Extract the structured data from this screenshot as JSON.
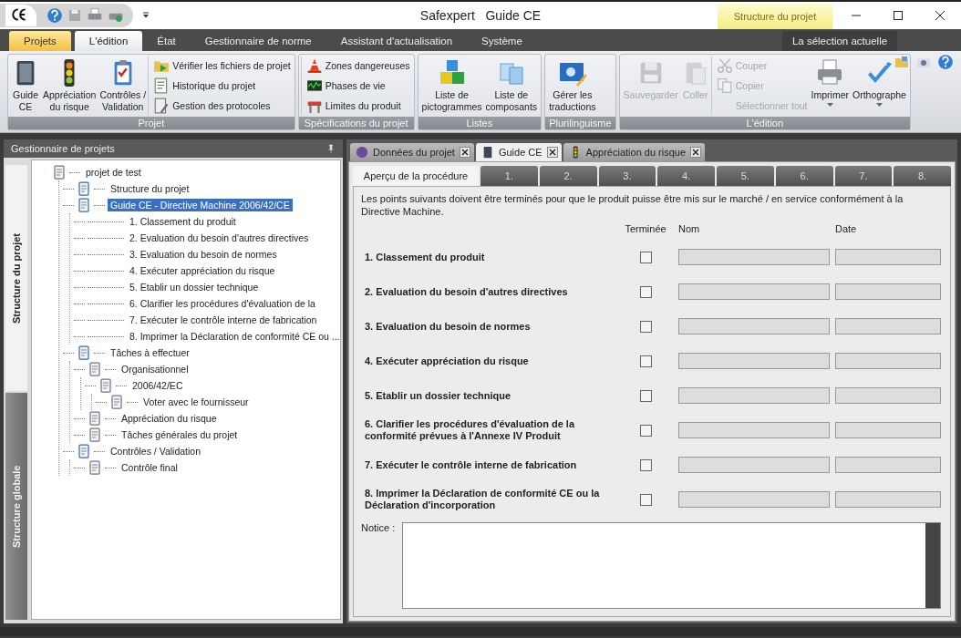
{
  "window": {
    "title": "Safexpert   Guide CE",
    "context_header": "Structure du projet"
  },
  "ribbon_tabs": [
    {
      "label": "Projets",
      "kind": "app",
      "selected": false
    },
    {
      "label": "L'édition",
      "kind": "tab",
      "selected": true
    },
    {
      "label": "État",
      "kind": "tab",
      "selected": false
    },
    {
      "label": "Gestionnaire de norme",
      "kind": "tab",
      "selected": false
    },
    {
      "label": "Assistant d'actualisation",
      "kind": "tab",
      "selected": false
    },
    {
      "label": "Système",
      "kind": "tab",
      "selected": false
    },
    {
      "label": "La sélection actuelle",
      "kind": "context",
      "selected": false
    }
  ],
  "ribbon_groups": [
    {
      "title": "Projet",
      "columns": [
        {
          "kind": "large",
          "label": "Guide\nCE",
          "disabled": false,
          "dropdown": false
        },
        {
          "kind": "large",
          "label": "Appréciation\ndu risque",
          "disabled": false,
          "dropdown": false
        },
        {
          "kind": "large",
          "label": "Contrôles /\nValidation",
          "disabled": false,
          "dropdown": false
        },
        {
          "kind": "stack",
          "items": [
            {
              "label": "Vérifier les fichiers de projet",
              "disabled": false
            },
            {
              "label": "Historique du projet",
              "disabled": false
            },
            {
              "label": "Gestion des protocoles",
              "disabled": false
            }
          ]
        }
      ]
    },
    {
      "title": "Spécifications du projet",
      "columns": [
        {
          "kind": "stack",
          "items": [
            {
              "label": "Zones dangereuses",
              "disabled": false
            },
            {
              "label": "Phases de vie",
              "disabled": false
            },
            {
              "label": "Limites du produit",
              "disabled": false
            }
          ]
        }
      ]
    },
    {
      "title": "Listes",
      "columns": [
        {
          "kind": "large",
          "label": "Liste de\npictogrammes",
          "disabled": false,
          "dropdown": false
        },
        {
          "kind": "large",
          "label": "Liste de\ncomposants",
          "disabled": false,
          "dropdown": false
        }
      ]
    },
    {
      "title": "Plurilinguisme",
      "columns": [
        {
          "kind": "large",
          "label": "Gérer les\ntraductions",
          "disabled": false,
          "dropdown": false
        }
      ]
    },
    {
      "title": "L'édition",
      "columns": [
        {
          "kind": "large",
          "label": "Sauvegarder",
          "disabled": true,
          "dropdown": false
        },
        {
          "kind": "large",
          "label": "Coller",
          "disabled": true,
          "dropdown": false
        },
        {
          "kind": "stack",
          "items": [
            {
              "label": "Couper",
              "disabled": true
            },
            {
              "label": "Copier",
              "disabled": true
            },
            {
              "label": "Sélectionner tout",
              "disabled": true
            }
          ]
        },
        {
          "kind": "large",
          "label": "Imprimer",
          "disabled": false,
          "dropdown": true
        },
        {
          "kind": "large",
          "label": "Orthographe",
          "disabled": false,
          "dropdown": true
        }
      ]
    }
  ],
  "project_manager": {
    "title": "Gestionnaire de projets",
    "side_tabs": [
      {
        "label": "Structure du projet",
        "selected": true
      },
      {
        "label": "Structure globale",
        "selected": false
      }
    ],
    "tree": [
      {
        "label": "projet de test",
        "kind": "document",
        "selected": false,
        "children": [
          {
            "label": "Structure du projet",
            "kind": "document",
            "selected": false
          },
          {
            "label": "Guide CE - Directive Machine 2006/42/CE",
            "kind": "document",
            "selected": true,
            "children": [
              {
                "label": "1. Classement du produit",
                "kind": "step",
                "selected": false
              },
              {
                "label": "2. Evaluation du besoin d'autres directives",
                "kind": "step",
                "selected": false
              },
              {
                "label": "3. Evaluation du besoin de normes",
                "kind": "step",
                "selected": false
              },
              {
                "label": "4. Exécuter appréciation du risque",
                "kind": "step",
                "selected": false
              },
              {
                "label": "5. Etablir un dossier technique",
                "kind": "step",
                "selected": false
              },
              {
                "label": "6. Clarifier les procédures d'évaluation de la",
                "kind": "step",
                "selected": false
              },
              {
                "label": "7. Exécuter le contrôle interne de fabrication",
                "kind": "step",
                "selected": false
              },
              {
                "label": "8. Imprimer la Déclaration de conformité CE ou ...",
                "kind": "step",
                "selected": false
              }
            ]
          },
          {
            "label": "Tâches à effectuer",
            "kind": "document",
            "selected": false,
            "children": [
              {
                "label": "Organisationnel",
                "kind": "document",
                "selected": false,
                "children": [
                  {
                    "label": "2006/42/EC",
                    "kind": "document",
                    "selected": false,
                    "children": [
                      {
                        "label": "Voter avec le fournisseur",
                        "kind": "document",
                        "selected": false
                      }
                    ]
                  }
                ]
              },
              {
                "label": "Appréciation du risque",
                "kind": "document",
                "selected": false
              },
              {
                "label": "Tâches générales du projet",
                "kind": "document",
                "selected": false
              }
            ]
          },
          {
            "label": "Contrôles / Validation",
            "kind": "document",
            "selected": false,
            "children": [
              {
                "label": "Contrôle final",
                "kind": "document",
                "selected": false
              }
            ]
          }
        ]
      }
    ]
  },
  "document_tabs": [
    {
      "label": "Données du projet",
      "selected": false
    },
    {
      "label": "Guide CE",
      "selected": true
    },
    {
      "label": "Appréciation du risque",
      "selected": false
    }
  ],
  "step_tabs": [
    {
      "label": "Aperçu de la procédure",
      "selected": true
    },
    {
      "label": "1.",
      "selected": false
    },
    {
      "label": "2.",
      "selected": false
    },
    {
      "label": "3.",
      "selected": false
    },
    {
      "label": "4.",
      "selected": false
    },
    {
      "label": "5.",
      "selected": false
    },
    {
      "label": "6.",
      "selected": false
    },
    {
      "label": "7.",
      "selected": false
    },
    {
      "label": "8.",
      "selected": false
    }
  ],
  "intro": "Les points suivants doivent être terminés pour que le produit puisse être mis sur le marché / en service conformément à la Directive Machine.",
  "columns": [
    "Terminée",
    "Nom",
    "Date"
  ],
  "steps": [
    {
      "label": "1. Classement du produit",
      "checked": false
    },
    {
      "label": "2. Evaluation du besoin d'autres directives",
      "checked": false
    },
    {
      "label": "3. Evaluation du besoin de normes",
      "checked": false
    },
    {
      "label": "4. Exécuter appréciation du risque",
      "checked": false
    },
    {
      "label": "5. Etablir un dossier technique",
      "checked": false
    },
    {
      "label": "6. Clarifier les procédures d'évaluation de la conformité prévues à l'Annexe IV Produit",
      "checked": false
    },
    {
      "label": "7. Exécuter le contrôle interne de fabrication",
      "checked": false
    },
    {
      "label": "8. Imprimer la Déclaration de conformité CE ou la Déclaration d'incorporation",
      "checked": false
    }
  ],
  "notice": {
    "label": "Notice :"
  }
}
